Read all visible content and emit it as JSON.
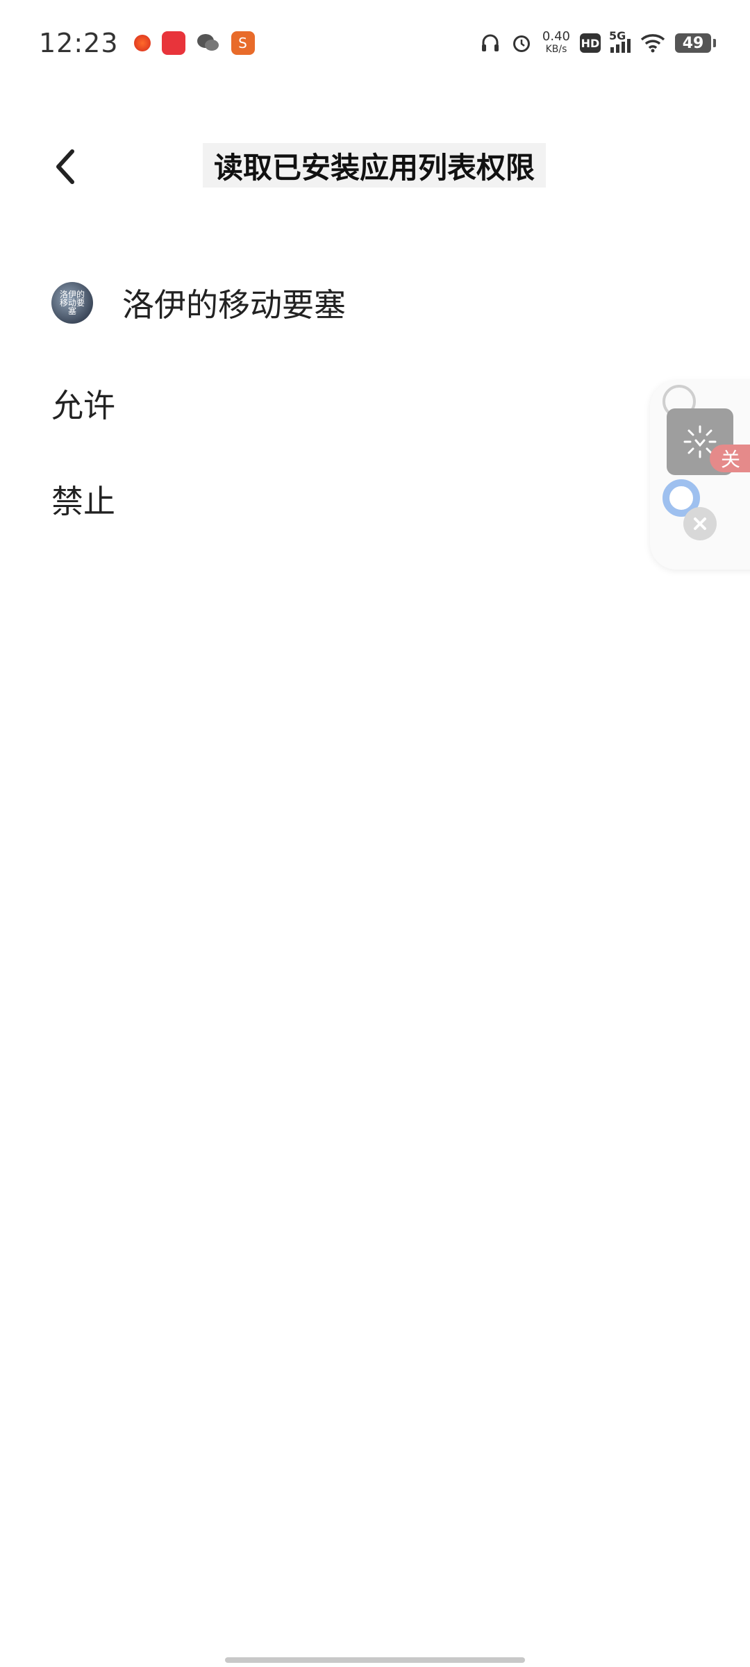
{
  "status_bar": {
    "time": "12:23",
    "net_speed_value": "0.40",
    "net_speed_unit": "KB/s",
    "hd_label": "HD",
    "signal_label": "5G",
    "battery_level": "49"
  },
  "header": {
    "title": "读取已安装应用列表权限"
  },
  "app": {
    "name": "洛伊的移动要塞",
    "avatar_text": "洛伊的移动要塞"
  },
  "options": {
    "allow": "允许",
    "deny": "禁止"
  },
  "float_panel": {
    "close_label": "关"
  },
  "colors": {
    "background": "#ffffff",
    "title_bg": "#f2f2f2",
    "close_tag": "#e58a8a",
    "ring_blue": "#9ec0ef"
  }
}
